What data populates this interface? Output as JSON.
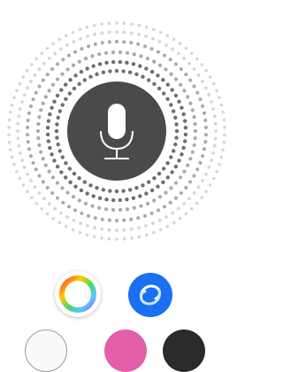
{
  "colors": {
    "mic_button_bg": "#4a4a4c",
    "mic_glyph": "#ffffff",
    "inner_dots": "#6e6e70",
    "middle_dots": "#a9a9ab",
    "outer_dots": "#d6d6d8",
    "blue_app": "#1a6ff2",
    "pink_app": "#e35fa8",
    "dark_app": "#2a2a2a"
  },
  "icons": {
    "mic": "microphone-icon",
    "color_wheel": "color-wheel-icon",
    "blue_app": "blue-swirl-icon",
    "partial_left": "app-icon",
    "partial_mid": "app-icon",
    "partial_right": "app-icon"
  },
  "voice_input": {
    "state": "listening"
  }
}
